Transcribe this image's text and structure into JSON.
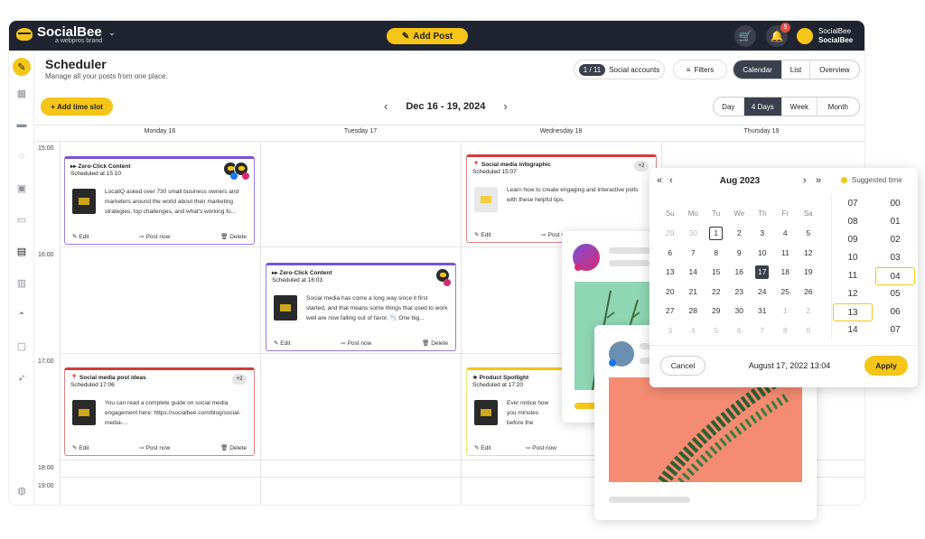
{
  "app": {
    "logo": "SocialBee",
    "logo_sub": "a webpros brand",
    "add_post": "Add Post",
    "notif_count": "5",
    "user_name": "SocialBee",
    "user_sub": "SocialBee"
  },
  "header": {
    "title": "Scheduler",
    "subtitle": "Manage all your posts from one place.",
    "accounts_count": "1 / 11",
    "accounts_label": "Social accounts",
    "filters": "Filters",
    "views": [
      "Calendar",
      "List",
      "Overview"
    ],
    "active_view": "Calendar"
  },
  "toolbar": {
    "add_slot": "Add time slot",
    "date_range": "Dec 16 - 19, 2024",
    "ranges": [
      "Day",
      "4 Days",
      "Week",
      "Month"
    ],
    "active_range": "4 Days"
  },
  "days": [
    "Monday 16",
    "Tuesday 17",
    "Wednesday 18",
    "Thursday 19"
  ],
  "times": [
    "15:00",
    "16:00",
    "17:00",
    "18:00",
    "19:00"
  ],
  "actions": {
    "edit": "Edit",
    "post_now": "Post now",
    "delete": "Delete"
  },
  "cards": [
    {
      "title": "Zero-Click Content",
      "icon": "fast-forward-icon",
      "scheduled": "Scheduled at 15:10",
      "body": "LocaliQ asked over 730 small business owners and marketers around the world about their marketing strategies, top challenges, and what's working fo...",
      "color": "#7b52d6"
    },
    {
      "title": "Zero-Click Content",
      "icon": "fast-forward-icon",
      "scheduled": "Scheduled at 16:03",
      "body": "Social media has come a long way since it first started, and that means some things that used to work well are now falling out of favor. 📉 One big...",
      "color": "#7b52d6"
    },
    {
      "title": "Social media infographic",
      "icon": "pin-icon",
      "scheduled": "Scheduled 15:07",
      "body": "Learn how to create engaging and interactive polls with these helpful tips.",
      "plus": "+2",
      "color": "#d63a3a"
    },
    {
      "title": "Social media post ideas",
      "icon": "pin-icon",
      "scheduled": "Scheduled 17:06",
      "body": "You can read a complete guide on social media engagement here: https://socialbee.com/blog/social-media-...",
      "plus": "+2",
      "color": "#d63a3a"
    },
    {
      "title": "Product Spotlight",
      "icon": "star-icon",
      "scheduled": "Scheduled at 17:20",
      "body": "Ever notice how you minutes before the",
      "color": "#f5c518"
    }
  ],
  "picker": {
    "month": "Aug 2023",
    "suggested": "Suggested time",
    "weekdays": [
      "Su",
      "Mo",
      "Tu",
      "We",
      "Th",
      "Fr",
      "Sa"
    ],
    "weeks": [
      [
        "29",
        "30",
        "1",
        "2",
        "3",
        "4",
        "5"
      ],
      [
        "6",
        "7",
        "8",
        "9",
        "10",
        "11",
        "12"
      ],
      [
        "13",
        "14",
        "15",
        "16",
        "17",
        "18",
        "19"
      ],
      [
        "20",
        "21",
        "22",
        "23",
        "24",
        "25",
        "26"
      ],
      [
        "27",
        "28",
        "29",
        "30",
        "31",
        "1",
        "2"
      ],
      [
        "3",
        "4",
        "5",
        "6",
        "7",
        "8",
        "9"
      ]
    ],
    "selected_day": "17",
    "today_day": "1",
    "hours": [
      "07",
      "08",
      "09",
      "10",
      "11",
      "12",
      "13",
      "14"
    ],
    "selected_hour": "13",
    "minutes": [
      "00",
      "01",
      "02",
      "03",
      "04",
      "05",
      "06",
      "07"
    ],
    "selected_minute": "04",
    "cancel": "Cancel",
    "summary": "August 17, 2022 13:04",
    "apply": "Apply"
  },
  "colors": {
    "brand": "#f5c518",
    "dark": "#1f2430",
    "instagram": "#d62976",
    "facebook": "#1877f2"
  }
}
